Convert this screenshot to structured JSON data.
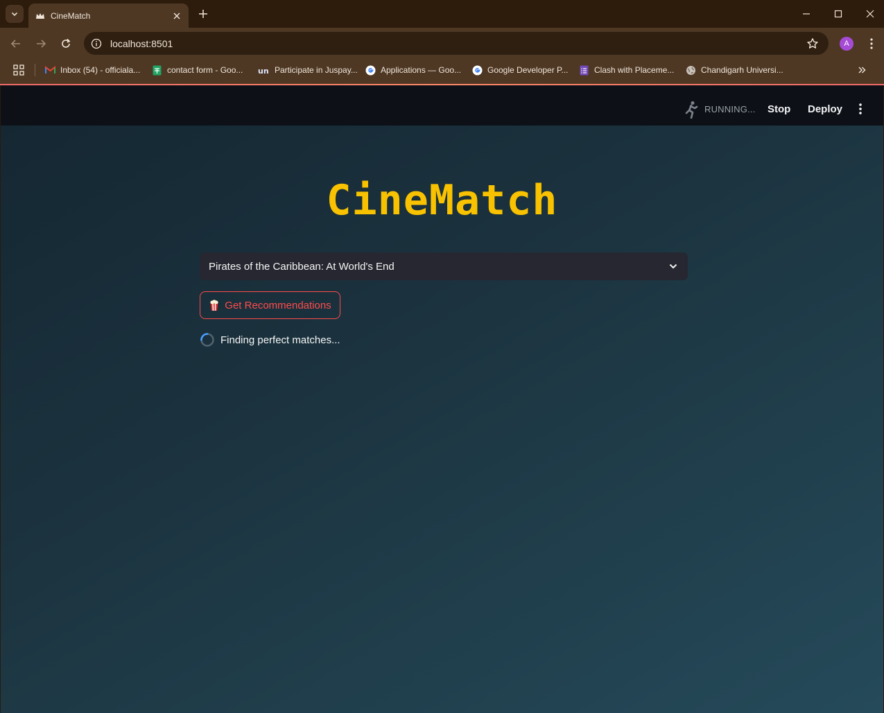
{
  "browser": {
    "tab_title": "CineMatch",
    "url": "localhost:8501",
    "profile_initial": "A",
    "bookmarks": [
      {
        "label": "Inbox (54) - officiala...",
        "icon": "gmail-icon"
      },
      {
        "label": "contact form - Goo...",
        "icon": "google-sheets-icon"
      },
      {
        "label": "Participate in Juspay...",
        "icon": "unstop-icon"
      },
      {
        "label": "Applications — Goo...",
        "icon": "google-icon"
      },
      {
        "label": "Google Developer P...",
        "icon": "google-icon"
      },
      {
        "label": "Clash with Placeme...",
        "icon": "google-forms-icon"
      },
      {
        "label": "Chandigarh Universi...",
        "icon": "globe-icon"
      }
    ]
  },
  "app": {
    "status": "RUNNING...",
    "stop_label": "Stop",
    "deploy_label": "Deploy",
    "title": "CineMatch",
    "select_value": "Pirates of the Caribbean: At World's End",
    "button_label": "Get Recommendations",
    "spinner_text": "Finding perfect matches..."
  },
  "colors": {
    "title": "#f8c200",
    "button_accent": "#ff4b4b",
    "select_bg": "#262730",
    "header_bg": "#0d1117"
  }
}
